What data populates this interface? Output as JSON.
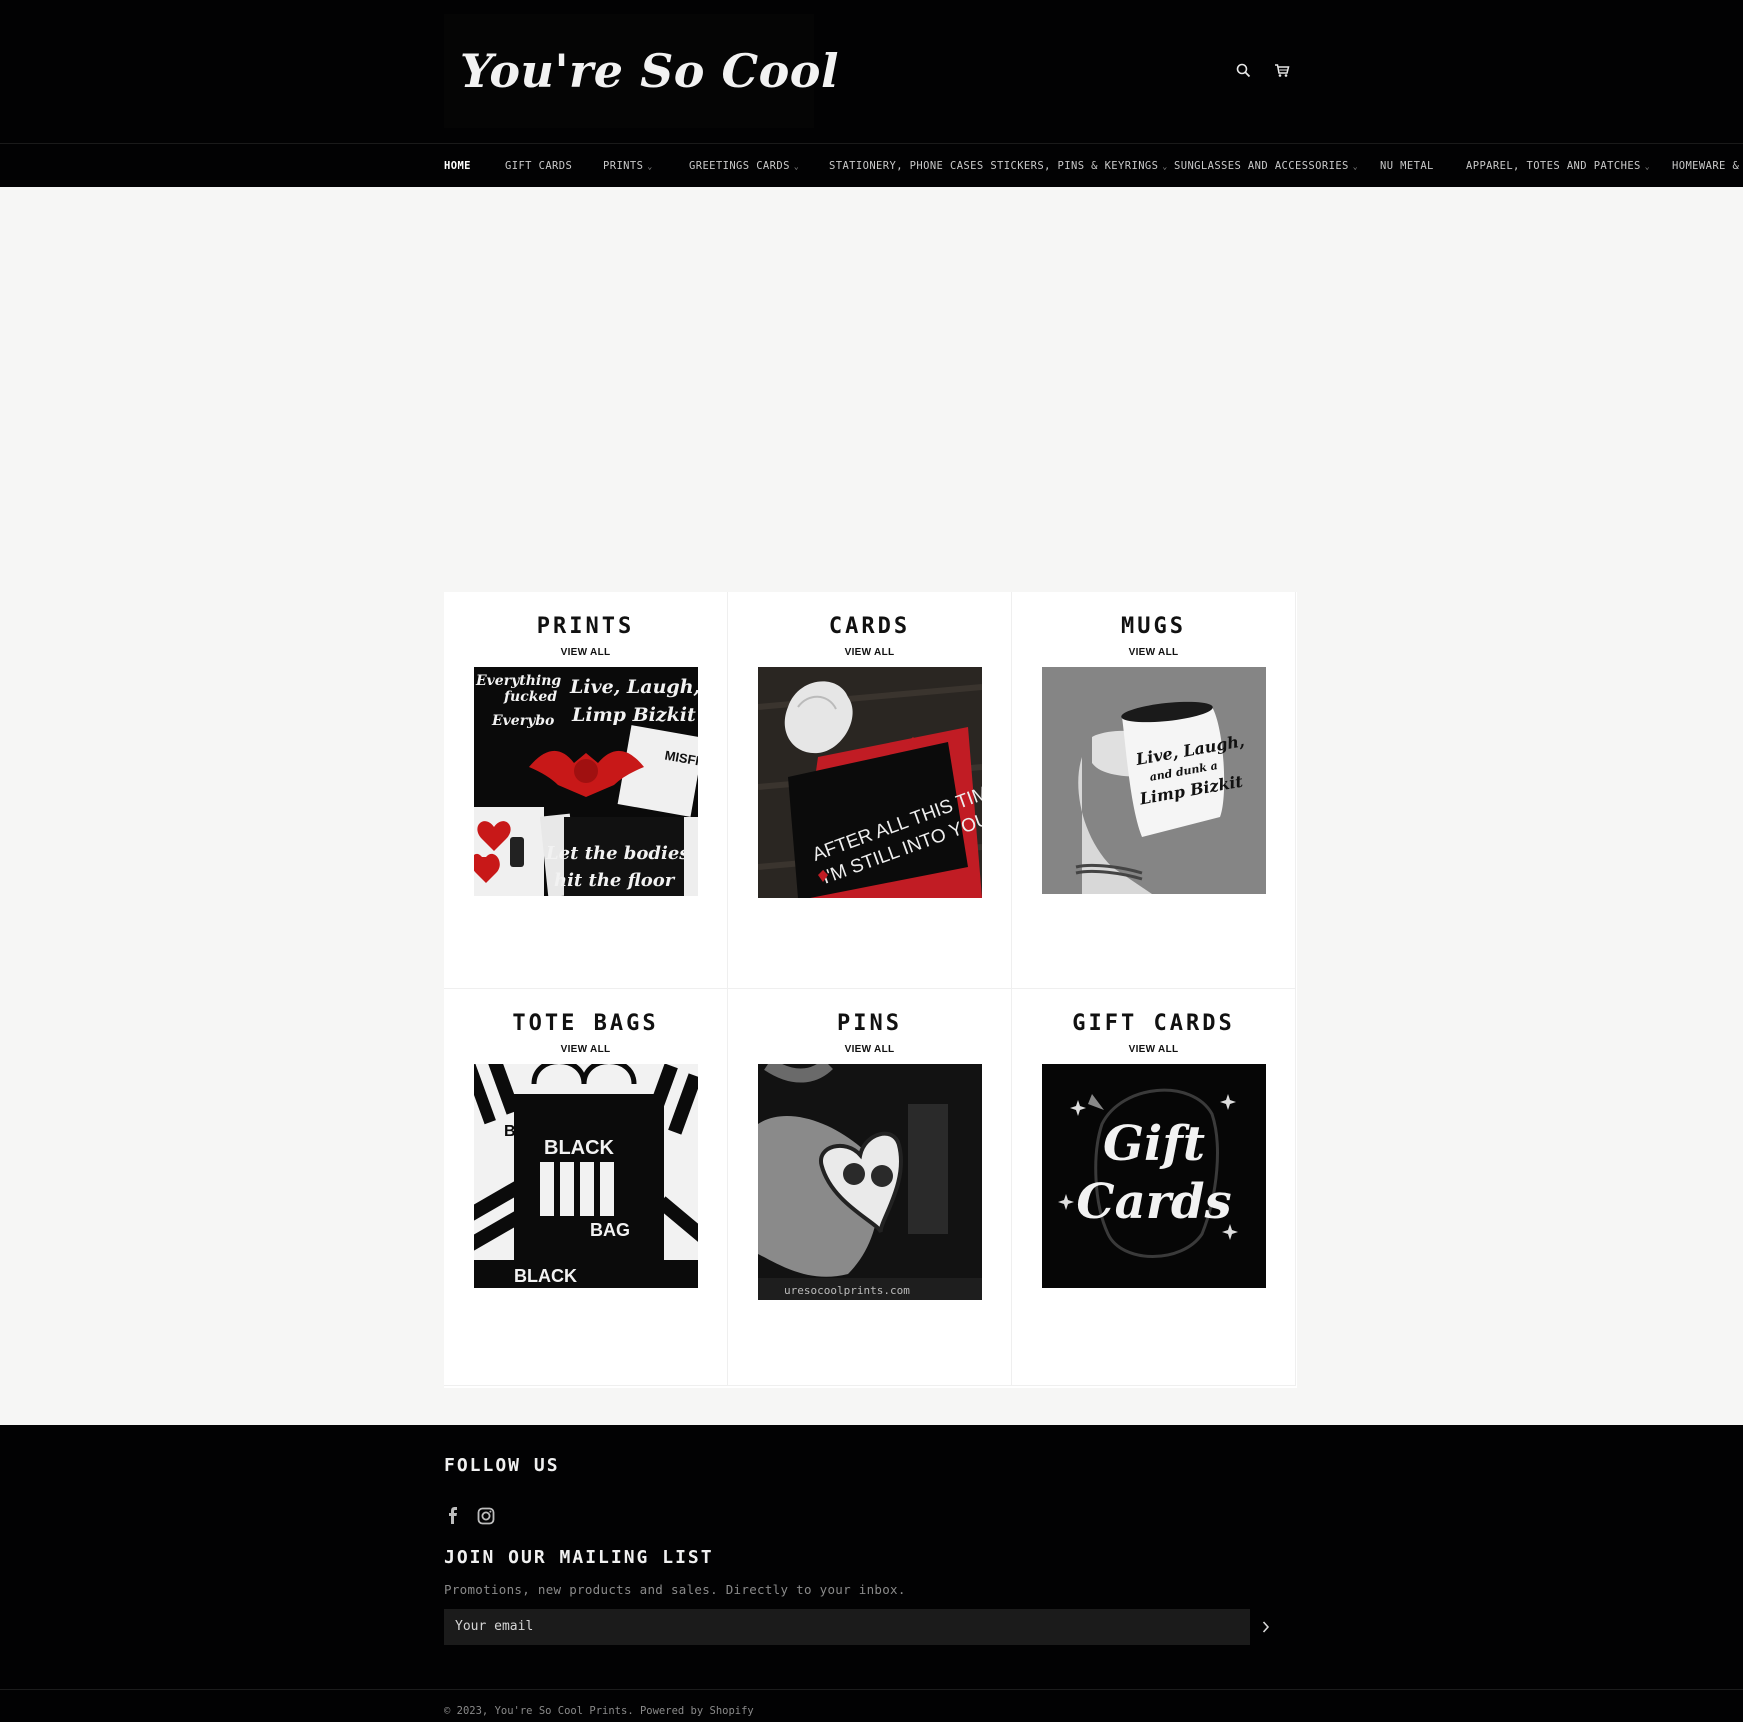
{
  "header": {
    "logo_text": "You're So Cool",
    "search_icon": "search-icon",
    "cart_icon": "cart-icon"
  },
  "nav": {
    "items": [
      {
        "label": "HOME",
        "has_dropdown": false,
        "active": true
      },
      {
        "label": "GIFT CARDS",
        "has_dropdown": false
      },
      {
        "label": "PRINTS",
        "has_dropdown": true
      },
      {
        "label": "GREETINGS CARDS",
        "has_dropdown": true
      },
      {
        "label": "STATIONERY, PHONE CASES STICKERS, PINS & KEYRINGS",
        "has_dropdown": true
      },
      {
        "label": "SUNGLASSES AND ACCESSORIES",
        "has_dropdown": true
      },
      {
        "label": "NU METAL",
        "has_dropdown": false
      },
      {
        "label": "APPAREL, TOTES AND PATCHES",
        "has_dropdown": true
      },
      {
        "label": "HOMEWARE & M",
        "has_dropdown": false
      }
    ],
    "caret": "⌄"
  },
  "collections": [
    {
      "title": "PRINTS",
      "link": "VIEW ALL"
    },
    {
      "title": "CARDS",
      "link": "VIEW ALL"
    },
    {
      "title": "MUGS",
      "link": "VIEW ALL"
    },
    {
      "title": "TOTE BAGS",
      "link": "VIEW ALL"
    },
    {
      "title": "PINS",
      "link": "VIEW ALL"
    },
    {
      "title": "GIFT CARDS",
      "link": "VIEW ALL"
    }
  ],
  "images": {
    "prints": {
      "line1": "Everything",
      "line2": "fucked",
      "line3": "Everybo",
      "line4": "Live, Laugh,",
      "line5": "Limp Bizkit",
      "line6": "Let the bodies",
      "line7": "hit the floor",
      "line8": "MISFI"
    },
    "cards": {
      "line1": "AFTER ALL THIS TIME",
      "line2": "I'M STILL INTO YOU"
    },
    "mugs": {
      "line1": "Live, Laugh,",
      "line2": "and dunk a",
      "line3": "Limp Bizkit"
    },
    "totes": {
      "line1": "BLACK",
      "line2": "BAG",
      "line3": "BLACK",
      "line4": "B"
    },
    "pins": {
      "line1": "uresocoolprints.com"
    },
    "gift": {
      "line1": "Gift",
      "line2": "Cards"
    }
  },
  "footer": {
    "follow_heading": "FOLLOW US",
    "mailing_heading": "JOIN OUR MAILING LIST",
    "mailing_text": "Promotions, new products and sales. Directly to your inbox.",
    "email_placeholder": "Your email",
    "submit_icon": "chevron-right-icon",
    "copyright": "© 2023, You're So Cool Prints. Powered by Shopify",
    "social": [
      "facebook-icon",
      "instagram-icon"
    ]
  }
}
